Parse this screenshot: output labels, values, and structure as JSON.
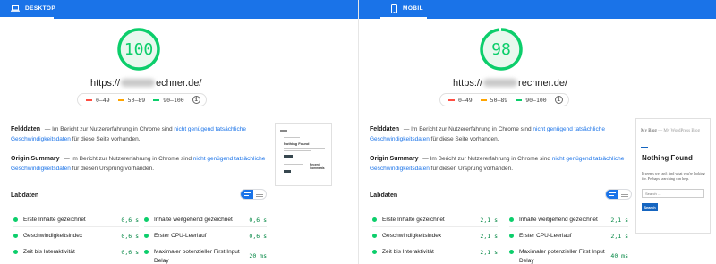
{
  "colors": {
    "accent": "#1a73e8",
    "pass": "#0cce6b",
    "average": "#ffa400",
    "fail": "#ff4e42",
    "pass_text": "#018642"
  },
  "left": {
    "tab_label": "DESKTOP",
    "tab_icon": "laptop-icon",
    "score": "100",
    "score_value": 100,
    "url_prefix": "https://",
    "url_suffix": "echner.de/",
    "legend": [
      "0–49",
      "50–89",
      "90–100"
    ],
    "felddaten": {
      "head": "Felddaten",
      "text1": "— Im Bericht zur Nutzererfahrung in Chrome sind",
      "link": "nicht genügend tatsächliche Geschwindigkeitsdaten",
      "text2": "für diese Seite vorhanden."
    },
    "origin": {
      "head": "Origin Summary",
      "text1": "— Im Bericht zur Nutzererfahrung in Chrome sind",
      "link": "nicht genügend tatsächliche Geschwindigkeitsdaten",
      "text2": "für diesen Ursprung vorhanden."
    },
    "thumb": {
      "title": "Nothing Found",
      "side_title": "Recent Comments"
    },
    "labdaten": "Labdaten",
    "metrics": [
      {
        "label": "Erste Inhalte gezeichnet",
        "value": "0,6 s"
      },
      {
        "label": "Inhalte weitgehend gezeichnet",
        "value": "0,6 s"
      },
      {
        "label": "Geschwindigkeitsindex",
        "value": "0,6 s"
      },
      {
        "label": "Erster CPU-Leerlauf",
        "value": "0,6 s"
      },
      {
        "label": "Zeit bis Interaktivität",
        "value": "0,6 s"
      },
      {
        "label": "Maximaler potenzieller First Input Delay",
        "value": "20 ms"
      }
    ]
  },
  "right": {
    "tab_label": "MOBIL",
    "tab_icon": "smartphone-icon",
    "score": "98",
    "score_value": 98,
    "url_prefix": "https://",
    "url_suffix": "rechner.de/",
    "legend": [
      "0–49",
      "50–89",
      "90–100"
    ],
    "felddaten": {
      "head": "Felddaten",
      "text1": "— Im Bericht zur Nutzererfahrung in Chrome sind",
      "link": "nicht genügend tatsächliche Geschwindigkeitsdaten",
      "text2": "für diese Seite vorhanden."
    },
    "origin": {
      "head": "Origin Summary",
      "text1": "— Im Bericht zur Nutzererfahrung in Chrome sind",
      "link": "nicht genügend tatsächliche Geschwindigkeitsdaten",
      "text2": "für diesen Ursprung vorhanden."
    },
    "thumb": {
      "site": "My Blog",
      "site_sub": "— My WordPress Blog",
      "title": "Nothing Found",
      "text": "It seems we can't find what you're looking for. Perhaps searching can help.",
      "search_placeholder": "Search …",
      "button": "Search"
    },
    "labdaten": "Labdaten",
    "metrics": [
      {
        "label": "Erste Inhalte gezeichnet",
        "value": "2,1 s"
      },
      {
        "label": "Inhalte weitgehend gezeichnet",
        "value": "2,1 s"
      },
      {
        "label": "Geschwindigkeitsindex",
        "value": "2,1 s"
      },
      {
        "label": "Erster CPU-Leerlauf",
        "value": "2,1 s"
      },
      {
        "label": "Zeit bis Interaktivität",
        "value": "2,1 s"
      },
      {
        "label": "Maximaler potenzieller First Input Delay",
        "value": "40 ms"
      }
    ]
  }
}
